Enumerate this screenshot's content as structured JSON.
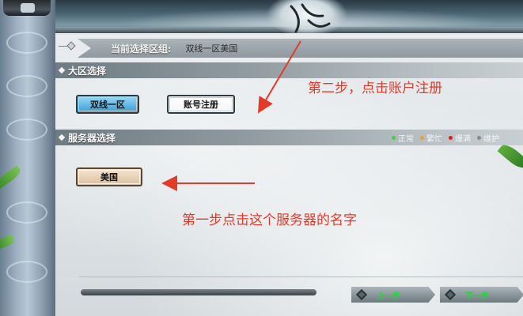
{
  "header": {
    "current_region_label": "当前选择区组:",
    "current_region_value": "双线一区美国"
  },
  "area_section": {
    "title": "大区选择",
    "buttons": {
      "area_1": "双线一区",
      "register": "账号注册"
    }
  },
  "server_section": {
    "title": "服务器选择",
    "legend": [
      {
        "label": "正常",
        "color": "#3fd13f"
      },
      {
        "label": "繁忙",
        "color": "#e8a23a"
      },
      {
        "label": "爆满",
        "color": "#e02020"
      },
      {
        "label": "维护",
        "color": "#8a8a8a"
      }
    ],
    "servers": [
      "美国"
    ]
  },
  "annotations": {
    "step2": "第二步，点击账户注册",
    "step1": "第一步点击这个服务器的名字",
    "color": "#e23b2a"
  },
  "footer": {
    "prev_label": "上一步",
    "next_label": "下一步"
  }
}
